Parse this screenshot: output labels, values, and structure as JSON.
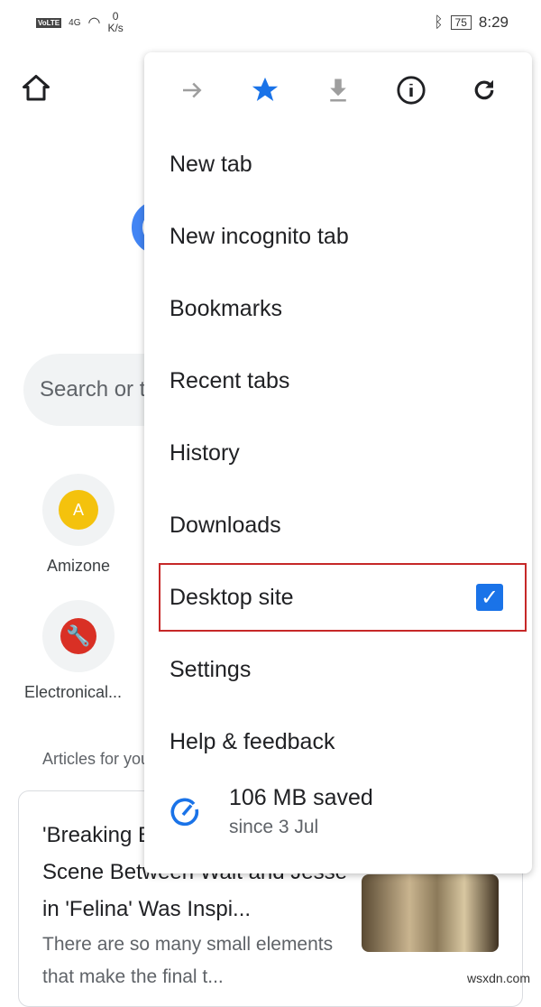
{
  "status": {
    "net": "4G",
    "speed_value": "0",
    "speed_unit": "K/s",
    "battery": "75",
    "time": "8:29",
    "volte": "VoLTE"
  },
  "page": {
    "search_placeholder": "Search or type web address",
    "tiles": [
      {
        "letter": "A",
        "label": "Amizone"
      },
      {
        "label": "Electronical..."
      }
    ],
    "articles_heading": "Articles for you",
    "article": {
      "title": "'Breaking Bad': The Final Scene Between Walt and Jesse in 'Felina' Was Inspi...",
      "snippet": "There are so many small elements that make the final t..."
    }
  },
  "menu": {
    "icons": [
      "forward-icon",
      "bookmark-star-icon",
      "download-icon",
      "info-icon",
      "reload-icon"
    ],
    "items": [
      "New tab",
      "New incognito tab",
      "Bookmarks",
      "Recent tabs",
      "History",
      "Downloads",
      "Desktop site",
      "Settings",
      "Help & feedback"
    ],
    "desktop_site_checked": true,
    "saved": "106 MB saved",
    "saved_since": "since 3 Jul"
  },
  "colors": {
    "accent": "#1a73e8",
    "highlight": "#c62828"
  },
  "watermark": "wsxdn.com"
}
